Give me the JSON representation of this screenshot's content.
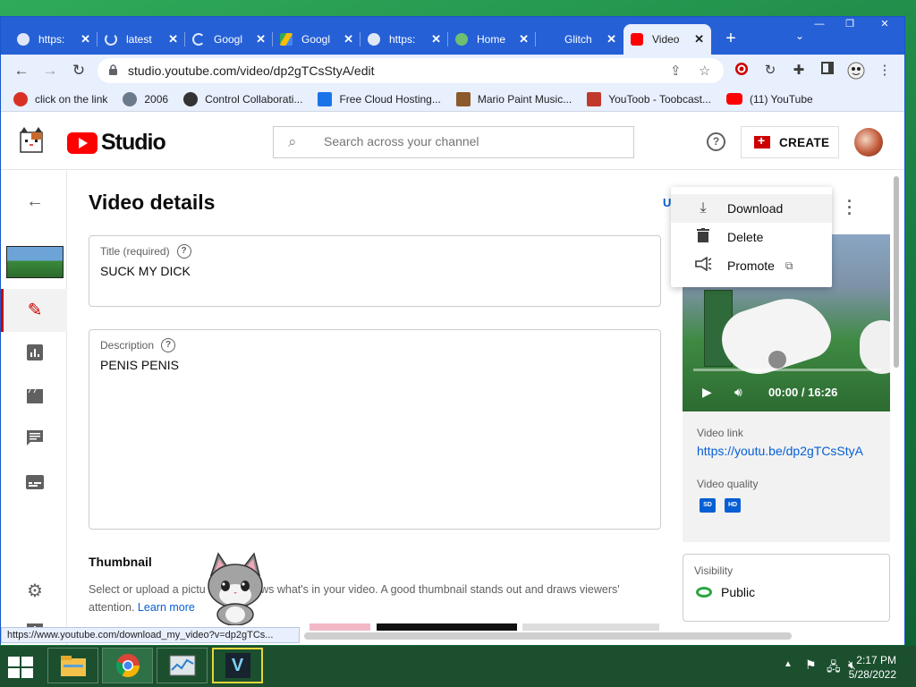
{
  "window": {
    "minimize": "—",
    "restore": "❐",
    "close": "✕"
  },
  "tabs": [
    {
      "label": "https:",
      "close": "✕",
      "icon": "page-icon"
    },
    {
      "label": "latest",
      "close": "✕",
      "icon": "loading-icon"
    },
    {
      "label": "Googl",
      "close": "✕",
      "icon": "loading-icon"
    },
    {
      "label": "Googl",
      "close": "✕",
      "icon": "drive-icon"
    },
    {
      "label": "https:",
      "close": "✕",
      "icon": "page-icon"
    },
    {
      "label": "Home",
      "close": "✕",
      "icon": "globe-icon"
    },
    {
      "label": "Glitch",
      "close": "✕",
      "icon": "glitch-icon"
    },
    {
      "label": "Video",
      "close": "✕",
      "icon": "youtube-icon"
    }
  ],
  "browser": {
    "new_tab": "+",
    "tab_menu": "⌄",
    "url": "studio.youtube.com/video/dp2gTCsStyA/edit",
    "status_url": "https://www.youtube.com/download_my_video?v=dp2gTCs..."
  },
  "bookmarks": [
    {
      "label": "click on the link",
      "color": "#d93025"
    },
    {
      "label": "2006",
      "color": "#6b7b8c"
    },
    {
      "label": "Control Collaborati...",
      "color": "#333333"
    },
    {
      "label": "Free Cloud Hosting...",
      "color": "#1a73e8"
    },
    {
      "label": "Mario Paint Music...",
      "color": "#8a5a2b"
    },
    {
      "label": "YouToob - Toobcast...",
      "color": "#c0392b"
    },
    {
      "label": "(11) YouTube",
      "color": "#ff0000"
    }
  ],
  "studio": {
    "brand": "Studio",
    "search_placeholder": "Search across your channel",
    "help": "?",
    "create": "CREATE",
    "page_title": "Video details",
    "undo_partial": "U",
    "title_label": "Title (required)",
    "title_value": "SUCK MY DICK",
    "description_label": "Description",
    "description_value": "PENIS PENIS",
    "help_glyph": "?",
    "thumbnail_heading": "Thumbnail",
    "thumbnail_text": "Select or upload a pictu",
    "thumbnail_text_2": "ws what's in your video. A good thumbnail stands out and draws viewers'",
    "thumbnail_text_3": "attention.",
    "learn_more": "Learn more"
  },
  "menu": {
    "items": [
      {
        "label": "Download",
        "icon": "download-icon"
      },
      {
        "label": "Delete",
        "icon": "trash-icon"
      },
      {
        "label": "Promote",
        "icon": "megaphone-icon"
      }
    ]
  },
  "player": {
    "time": "00:00 / 16:26",
    "video_link_label": "Video link",
    "video_link": "https://youtu.be/dp2gTCsStyA",
    "quality_label": "Video quality",
    "quality_sd": "SD",
    "quality_hd": "HD"
  },
  "visibility": {
    "label": "Visibility",
    "value": "Public"
  },
  "taskbar": {
    "time": "2:17 PM",
    "date": "5/28/2022",
    "vegas_letter": "V"
  },
  "colors": {
    "accent": "#065fd4",
    "youtube_red": "#ff0000",
    "public_green": "#2ba640",
    "tab_strip": "#2560d6"
  }
}
